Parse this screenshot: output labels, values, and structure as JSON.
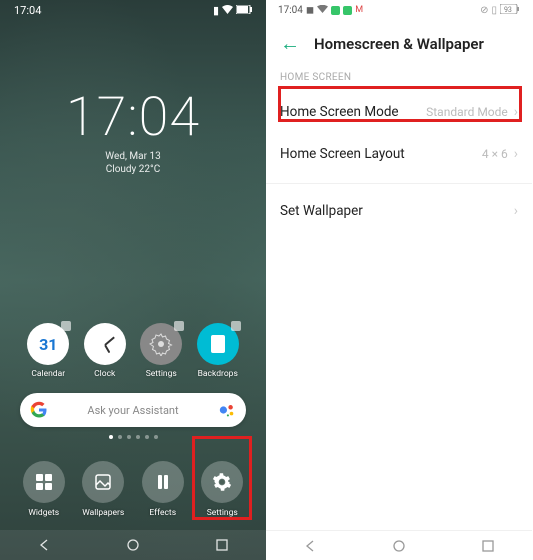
{
  "left": {
    "status_time": "17:04",
    "clock_time": "17:04",
    "date": "Wed, Mar 13",
    "weather": "Cloudy 22°C",
    "apps": [
      {
        "label": "Calendar",
        "date": "31"
      },
      {
        "label": "Clock"
      },
      {
        "label": "Settings"
      },
      {
        "label": "Backdrops"
      }
    ],
    "search_placeholder": "Ask your Assistant",
    "bottom": [
      {
        "label": "Widgets"
      },
      {
        "label": "Wallpapers"
      },
      {
        "label": "Effects"
      },
      {
        "label": "Settings"
      }
    ]
  },
  "right": {
    "status_time": "17:04",
    "battery": "93",
    "title": "Homescreen & Wallpaper",
    "section": "HOME SCREEN",
    "rows": [
      {
        "label": "Home Screen Mode",
        "value": "Standard Mode"
      },
      {
        "label": "Home Screen Layout",
        "value": "4 × 6"
      },
      {
        "label": "Set Wallpaper",
        "value": ""
      }
    ]
  }
}
